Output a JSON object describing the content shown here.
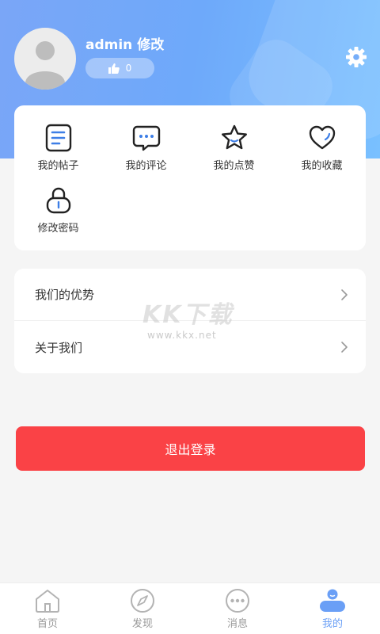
{
  "profile": {
    "username": "admin 修改",
    "likes": "0"
  },
  "menu": {
    "items": [
      {
        "label": "我的帖子",
        "icon": "document-icon"
      },
      {
        "label": "我的评论",
        "icon": "comment-icon"
      },
      {
        "label": "我的点赞",
        "icon": "star-icon"
      },
      {
        "label": "我的收藏",
        "icon": "heart-icon"
      },
      {
        "label": "修改密码",
        "icon": "lock-icon"
      }
    ]
  },
  "list": {
    "advantages": "我们的优势",
    "about": "关于我们"
  },
  "watermark": {
    "brand": "KK下载",
    "url": "www.kkx.net"
  },
  "logout_label": "退出登录",
  "tabbar": {
    "items": [
      {
        "label": "首页",
        "icon": "home-icon"
      },
      {
        "label": "发现",
        "icon": "compass-icon"
      },
      {
        "label": "消息",
        "icon": "message-icon"
      },
      {
        "label": "我的",
        "icon": "profile-icon"
      }
    ],
    "active_index": 3
  },
  "colors": {
    "header_gradient_start": "#7aa6f7",
    "header_gradient_end": "#79c0ff",
    "logout": "#fa4246",
    "active_tab": "#6a9ff6",
    "menu_icon_accent": "#3d7ee6"
  }
}
